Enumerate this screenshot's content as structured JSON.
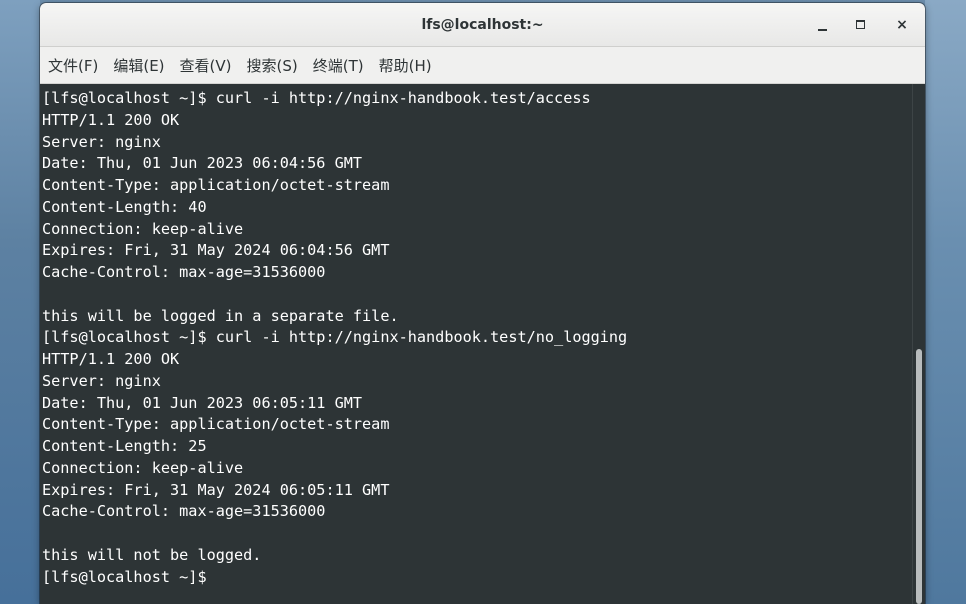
{
  "window": {
    "title": "lfs@localhost:~"
  },
  "controls": {
    "minimize_icon": "minimize-icon",
    "maximize_icon": "maximize-icon",
    "close_label": "×"
  },
  "menubar": {
    "items": [
      {
        "label": "文件(F)"
      },
      {
        "label": "编辑(E)"
      },
      {
        "label": "查看(V)"
      },
      {
        "label": "搜索(S)"
      },
      {
        "label": "终端(T)"
      },
      {
        "label": "帮助(H)"
      }
    ]
  },
  "terminal": {
    "lines": [
      "[lfs@localhost ~]$ curl -i http://nginx-handbook.test/access",
      "HTTP/1.1 200 OK",
      "Server: nginx",
      "Date: Thu, 01 Jun 2023 06:04:56 GMT",
      "Content-Type: application/octet-stream",
      "Content-Length: 40",
      "Connection: keep-alive",
      "Expires: Fri, 31 May 2024 06:04:56 GMT",
      "Cache-Control: max-age=31536000",
      "",
      "this will be logged in a separate file.",
      "[lfs@localhost ~]$ curl -i http://nginx-handbook.test/no_logging",
      "HTTP/1.1 200 OK",
      "Server: nginx",
      "Date: Thu, 01 Jun 2023 06:05:11 GMT",
      "Content-Type: application/octet-stream",
      "Content-Length: 25",
      "Connection: keep-alive",
      "Expires: Fri, 31 May 2024 06:05:11 GMT",
      "Cache-Control: max-age=31536000",
      "",
      "this will not be logged.",
      "[lfs@localhost ~]$ "
    ]
  },
  "colors": {
    "terminal_background": "#2d3436",
    "terminal_foreground": "#ffffff",
    "titlebar_background": "#ececeb"
  }
}
